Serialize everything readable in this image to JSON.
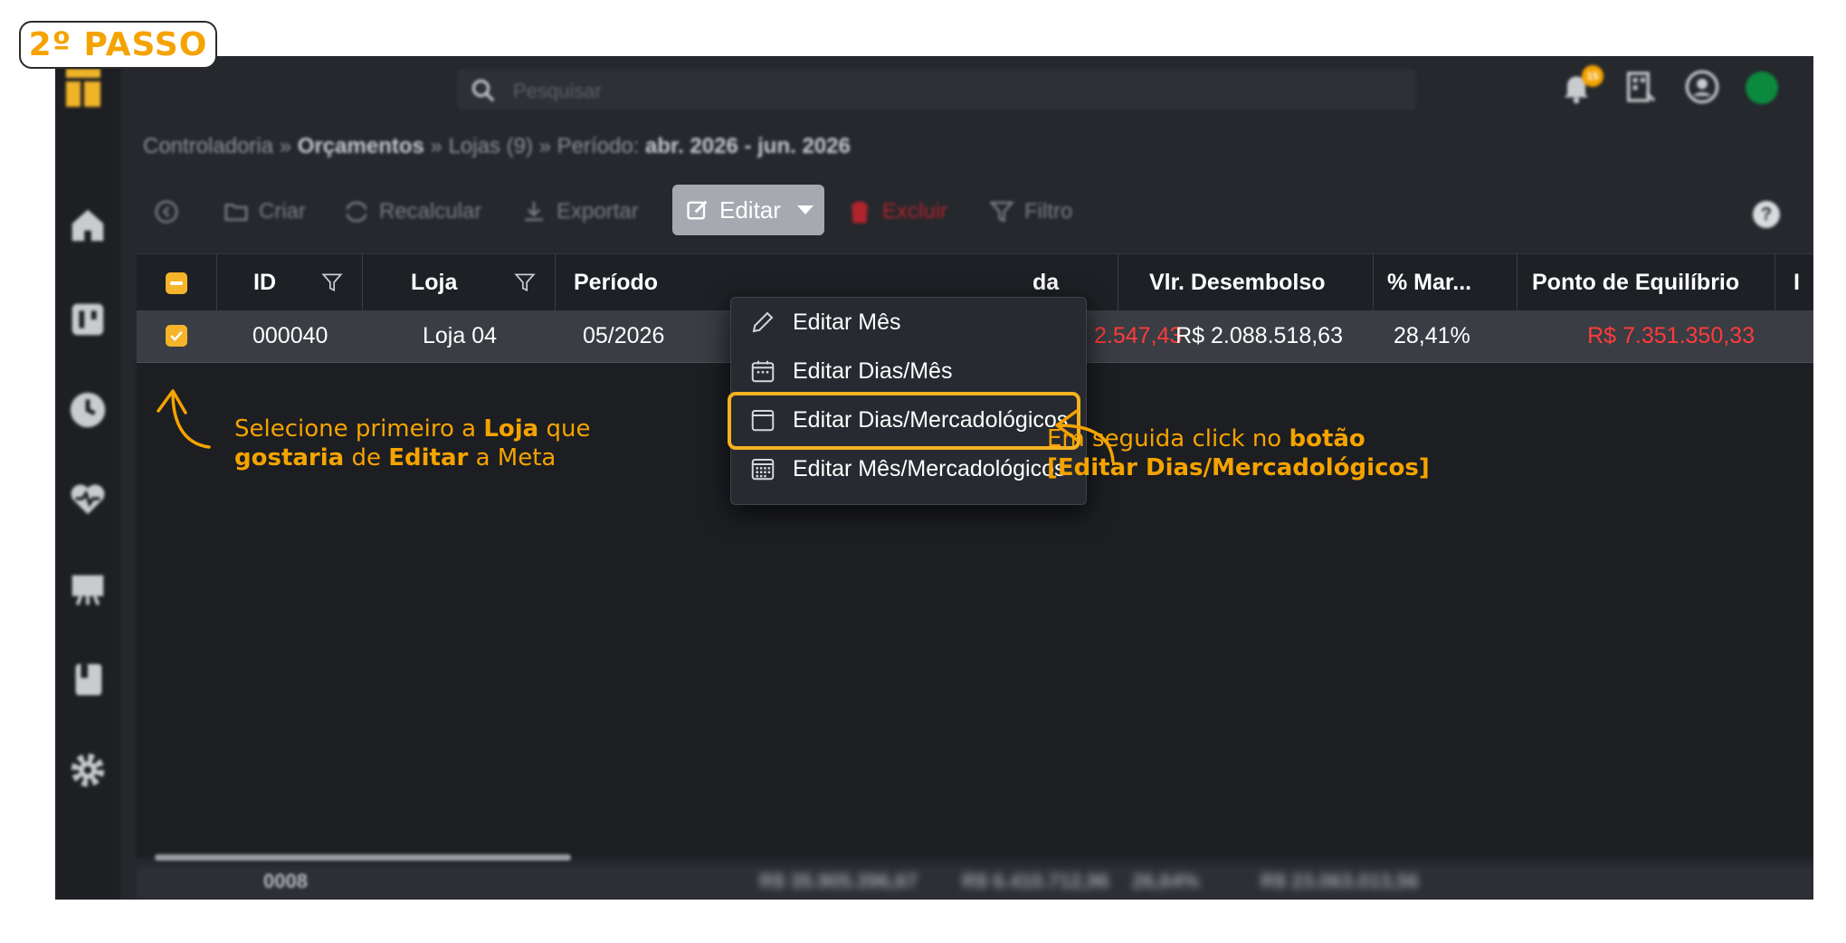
{
  "step_badge": "2º PASSO",
  "search": {
    "placeholder": "Pesquisar"
  },
  "topbar": {
    "notification_count": "15"
  },
  "breadcrumb": {
    "part1": "Controladoria",
    "sep": "»",
    "part2": "Orçamentos",
    "part3": "Lojas (9)",
    "part4_label": "Período:",
    "part4_value": "abr. 2026 - jun. 2026"
  },
  "toolbar": {
    "criar": "Criar",
    "recalcular": "Recalcular",
    "exportar": "Exportar",
    "editar": "Editar",
    "excluir": "Excluir",
    "filtro": "Filtro",
    "help": "?"
  },
  "menu": {
    "items": [
      {
        "label": "Editar Mês",
        "icon": "pencil-icon"
      },
      {
        "label": "Editar Dias/Mês",
        "icon": "calendar-days-icon"
      },
      {
        "label": "Editar Dias/Mercadológicos",
        "icon": "window-icon"
      },
      {
        "label": "Editar Mês/Mercadológicos",
        "icon": "calendar-grid-icon"
      }
    ]
  },
  "table": {
    "columns": [
      "ID",
      "Loja",
      "Período",
      "da",
      "Vlr. Desembolso",
      "% Mar...",
      "Ponto de Equilíbrio",
      "I"
    ],
    "row": {
      "id": "000040",
      "loja": "Loja 04",
      "periodo": "05/2026",
      "venda": "2.547,43",
      "desembolso": "R$ 2.088.518,63",
      "margem": "28,41%",
      "ponto_equilibrio": "R$ 7.351.350,33"
    },
    "footer": {
      "count": "0008",
      "total1": "R$ 35.905.396,67",
      "total2": "R$ 6.410.712,96",
      "total3": "26,64%",
      "total4": "R$ 23.063.013,56"
    }
  },
  "annotations": {
    "left": {
      "t1": "Selecione primeiro a ",
      "b1": "Loja",
      "t2": " que",
      "b2": "gostaria",
      "t3": " de ",
      "b3": "Editar",
      "t4": " a Meta"
    },
    "right": {
      "t1": "Em seguida click no ",
      "b1": "botão",
      "b2": "[Editar Dias/Mercadológicos]"
    }
  },
  "colors": {
    "accent": "#f5a300",
    "danger": "#ff3b3b",
    "highlight": "#f5b21f"
  }
}
